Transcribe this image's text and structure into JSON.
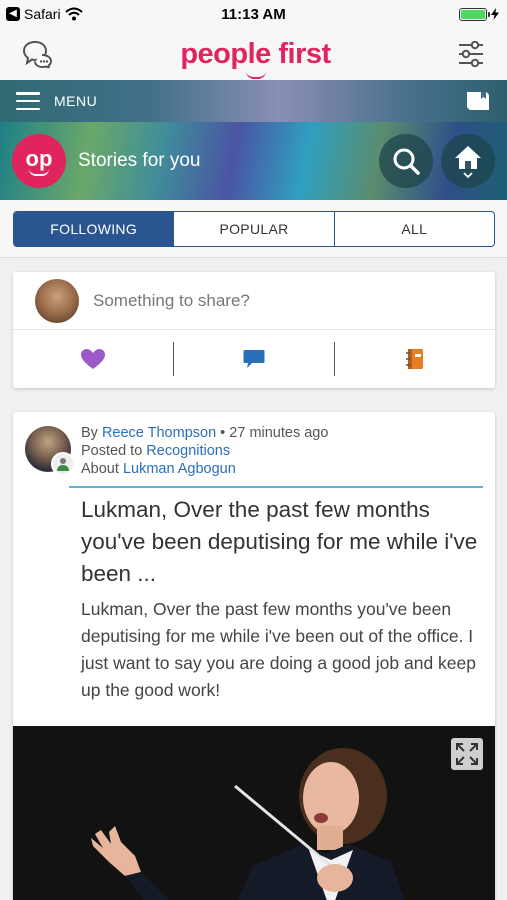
{
  "status_bar": {
    "back_app": "Safari",
    "time": "11:13 AM",
    "battery_level": 1.0,
    "battery_color": "#4cd964"
  },
  "header": {
    "logo_text": "people first",
    "brand_color": "#e0245e",
    "left_icon": "chat-bubbles-icon",
    "right_icon": "sliders-icon"
  },
  "menu_bar": {
    "label": "MENU",
    "right_icon": "bookmark-book-icon"
  },
  "banner": {
    "avatar_text": "op",
    "title": "Stories for you",
    "search_icon": "search-icon",
    "home_icon": "home-icon"
  },
  "tabs": [
    {
      "label": "FOLLOWING",
      "active": true
    },
    {
      "label": "POPULAR",
      "active": false
    },
    {
      "label": "ALL",
      "active": false
    }
  ],
  "accent_color": "#2a5590",
  "share": {
    "placeholder": "Something to share?",
    "actions": [
      {
        "icon": "heart-icon",
        "color": "#9b59c9"
      },
      {
        "icon": "speech-bubble-icon",
        "color": "#2a6fb8"
      },
      {
        "icon": "notebook-icon",
        "color": "#e67e22"
      }
    ]
  },
  "post": {
    "by_prefix": "By",
    "author": "Reece Thompson",
    "time_ago": "27 minutes ago",
    "posted_prefix": "Posted to",
    "channel": "Recognitions",
    "about_prefix": "About",
    "subject": "Lukman Agbogun",
    "title": "Lukman, Over the past few months you've been deputising for me while i've been ...",
    "body": "Lukman, Over the past few months you've been deputising for me while i've been out of the office. I just want to say you are doing a good job and keep up the good work!",
    "image_icon": "expand-icon"
  }
}
